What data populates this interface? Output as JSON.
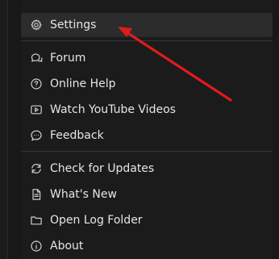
{
  "menu": {
    "items": [
      {
        "id": "settings",
        "label": "Settings",
        "icon": "gear-icon"
      },
      {
        "id": "forum",
        "label": "Forum",
        "icon": "chat-icon"
      },
      {
        "id": "online-help",
        "label": "Online Help",
        "icon": "help-circle-icon"
      },
      {
        "id": "watch-youtube-videos",
        "label": "Watch YouTube Videos",
        "icon": "video-play-icon"
      },
      {
        "id": "feedback",
        "label": "Feedback",
        "icon": "feedback-bubble-icon"
      },
      {
        "id": "check-for-updates",
        "label": "Check for Updates",
        "icon": "refresh-icon"
      },
      {
        "id": "whats-new",
        "label": "What's New",
        "icon": "document-icon"
      },
      {
        "id": "open-log-folder",
        "label": "Open Log Folder",
        "icon": "folder-icon"
      },
      {
        "id": "about",
        "label": "About",
        "icon": "info-icon"
      }
    ]
  },
  "annotation": {
    "arrow_color": "#e01b1b"
  },
  "colors": {
    "background": "#181818",
    "menu_background": "#1b1b1b",
    "active_item_background": "#2c2c2c",
    "text": "#e6e6e6",
    "icon": "#cfcfcf",
    "divider": "#343434"
  }
}
